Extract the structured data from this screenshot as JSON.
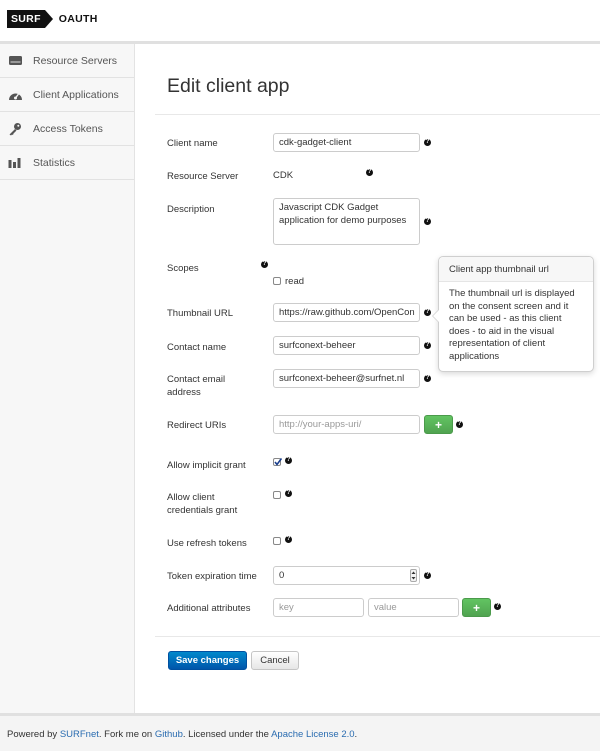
{
  "brand": {
    "surf": "SURF",
    "oauth": "OAUTH",
    "colors": {
      "logo_bg": "#111111",
      "primary": "#0074cc",
      "success": "#5bb75b",
      "link": "#2a6cb0"
    }
  },
  "sidebar": {
    "items": [
      {
        "label": "Resource Servers",
        "icon": "server-icon"
      },
      {
        "label": "Client Applications",
        "icon": "dashboard-icon"
      },
      {
        "label": "Access Tokens",
        "icon": "key-icon"
      },
      {
        "label": "Statistics",
        "icon": "bar-chart-icon"
      }
    ]
  },
  "page": {
    "title": "Edit client app"
  },
  "form": {
    "client_name": {
      "label": "Client name",
      "value": "cdk-gadget-client"
    },
    "resource_server": {
      "label": "Resource Server",
      "value": "CDK"
    },
    "description": {
      "label": "Description",
      "value": "Javascript CDK Gadget application for demo purposes"
    },
    "scopes": {
      "label": "Scopes",
      "options": [
        {
          "label": "read",
          "checked": false
        }
      ]
    },
    "thumbnail_url": {
      "label": "Thumbnail URL",
      "value": "https://raw.github.com/OpenCon"
    },
    "contact_name": {
      "label": "Contact name",
      "value": "surfconext-beheer"
    },
    "contact_email": {
      "label": "Contact email address",
      "value": "surfconext-beheer@surfnet.nl"
    },
    "redirect_uris": {
      "label": "Redirect URIs",
      "placeholder": "http://your-apps-uri/"
    },
    "allow_implicit_grant": {
      "label": "Allow implicit grant",
      "checked": true
    },
    "allow_client_credentials_grant": {
      "label": "Allow client credentials grant",
      "checked": false
    },
    "use_refresh_tokens": {
      "label": "Use refresh tokens",
      "checked": false
    },
    "token_expiration_time": {
      "label": "Token expiration time",
      "value": "0"
    },
    "additional_attributes": {
      "label": "Additional attributes",
      "key_placeholder": "key",
      "value_placeholder": "value"
    },
    "add_label": "+",
    "help_glyph": "?",
    "save_label": "Save changes",
    "cancel_label": "Cancel"
  },
  "popover": {
    "title": "Client app thumbnail url",
    "body": "The thumbnail url is displayed on the consent screen and it can be used - as this client does - to aid in the visual representation of client applications"
  },
  "footer": {
    "t1": "Powered by ",
    "surfnet": "SURFnet",
    "t2": ". Fork me on ",
    "github": "Github",
    "t3": ". Licensed under the ",
    "license": "Apache License 2.0",
    "t4": "."
  }
}
